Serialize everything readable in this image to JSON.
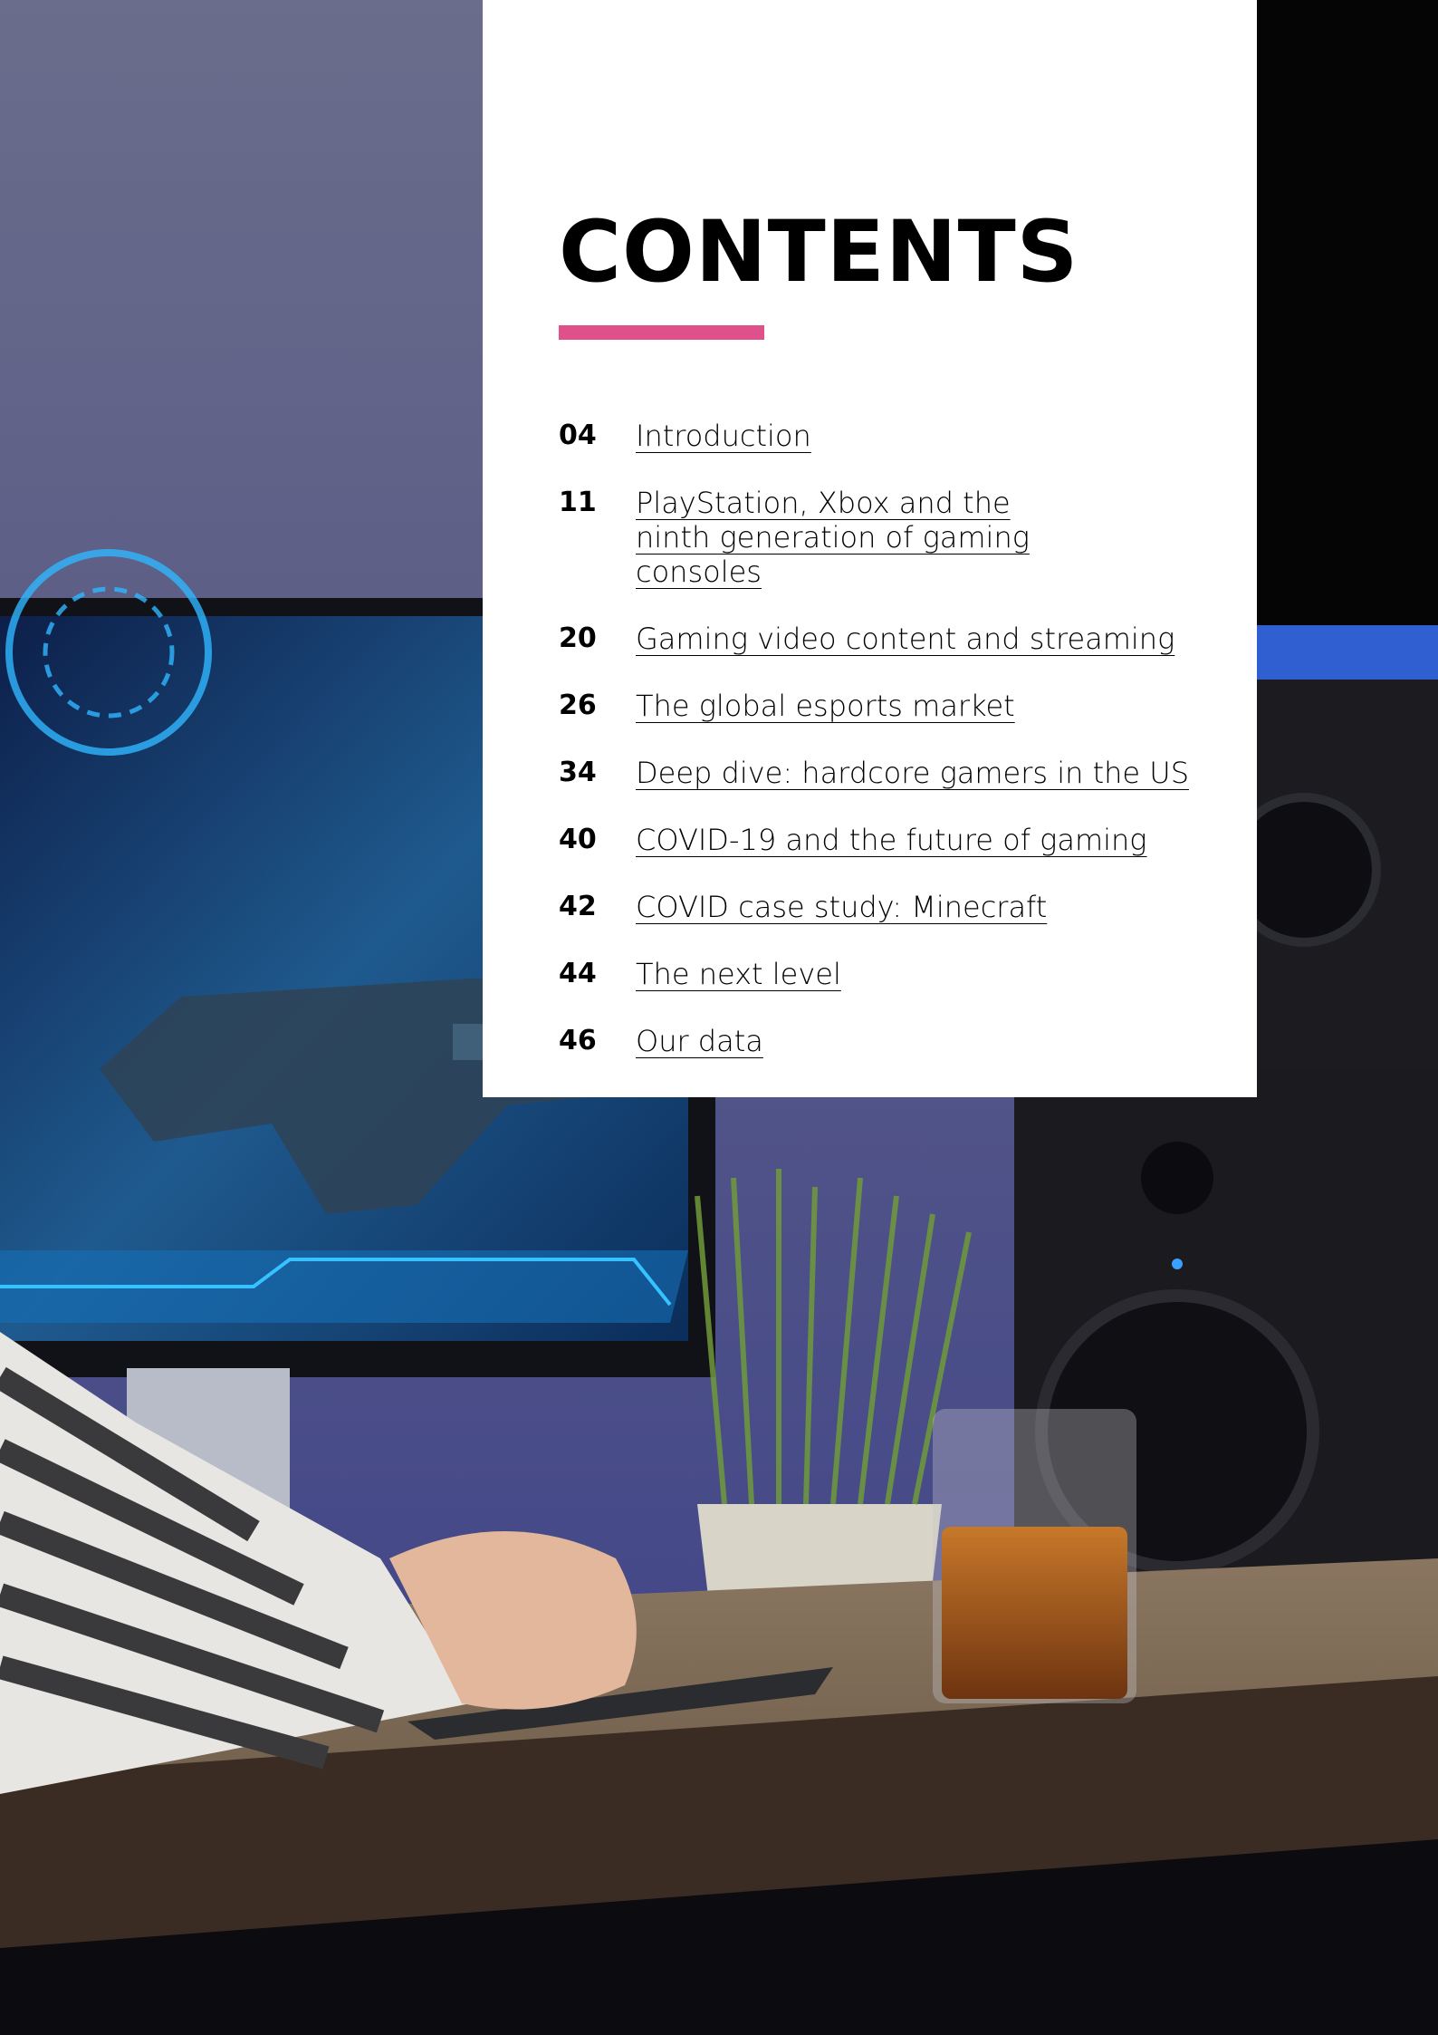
{
  "title": "CONTENTS",
  "accent_color": "#e0508a",
  "toc": [
    {
      "page": "04",
      "title": "Introduction"
    },
    {
      "page": "11",
      "title": "PlayStation, Xbox and the ninth generation of gaming consoles"
    },
    {
      "page": "20",
      "title": "Gaming video content and streaming"
    },
    {
      "page": "26",
      "title": "The global esports market"
    },
    {
      "page": "34",
      "title": "Deep dive: hardcore gamers in the US"
    },
    {
      "page": "40",
      "title": "COVID-19 and the future of gaming"
    },
    {
      "page": "42",
      "title": "COVID case study: Minecraft"
    },
    {
      "page": "44",
      "title": "The next level"
    },
    {
      "page": "46",
      "title": "Our data"
    }
  ]
}
